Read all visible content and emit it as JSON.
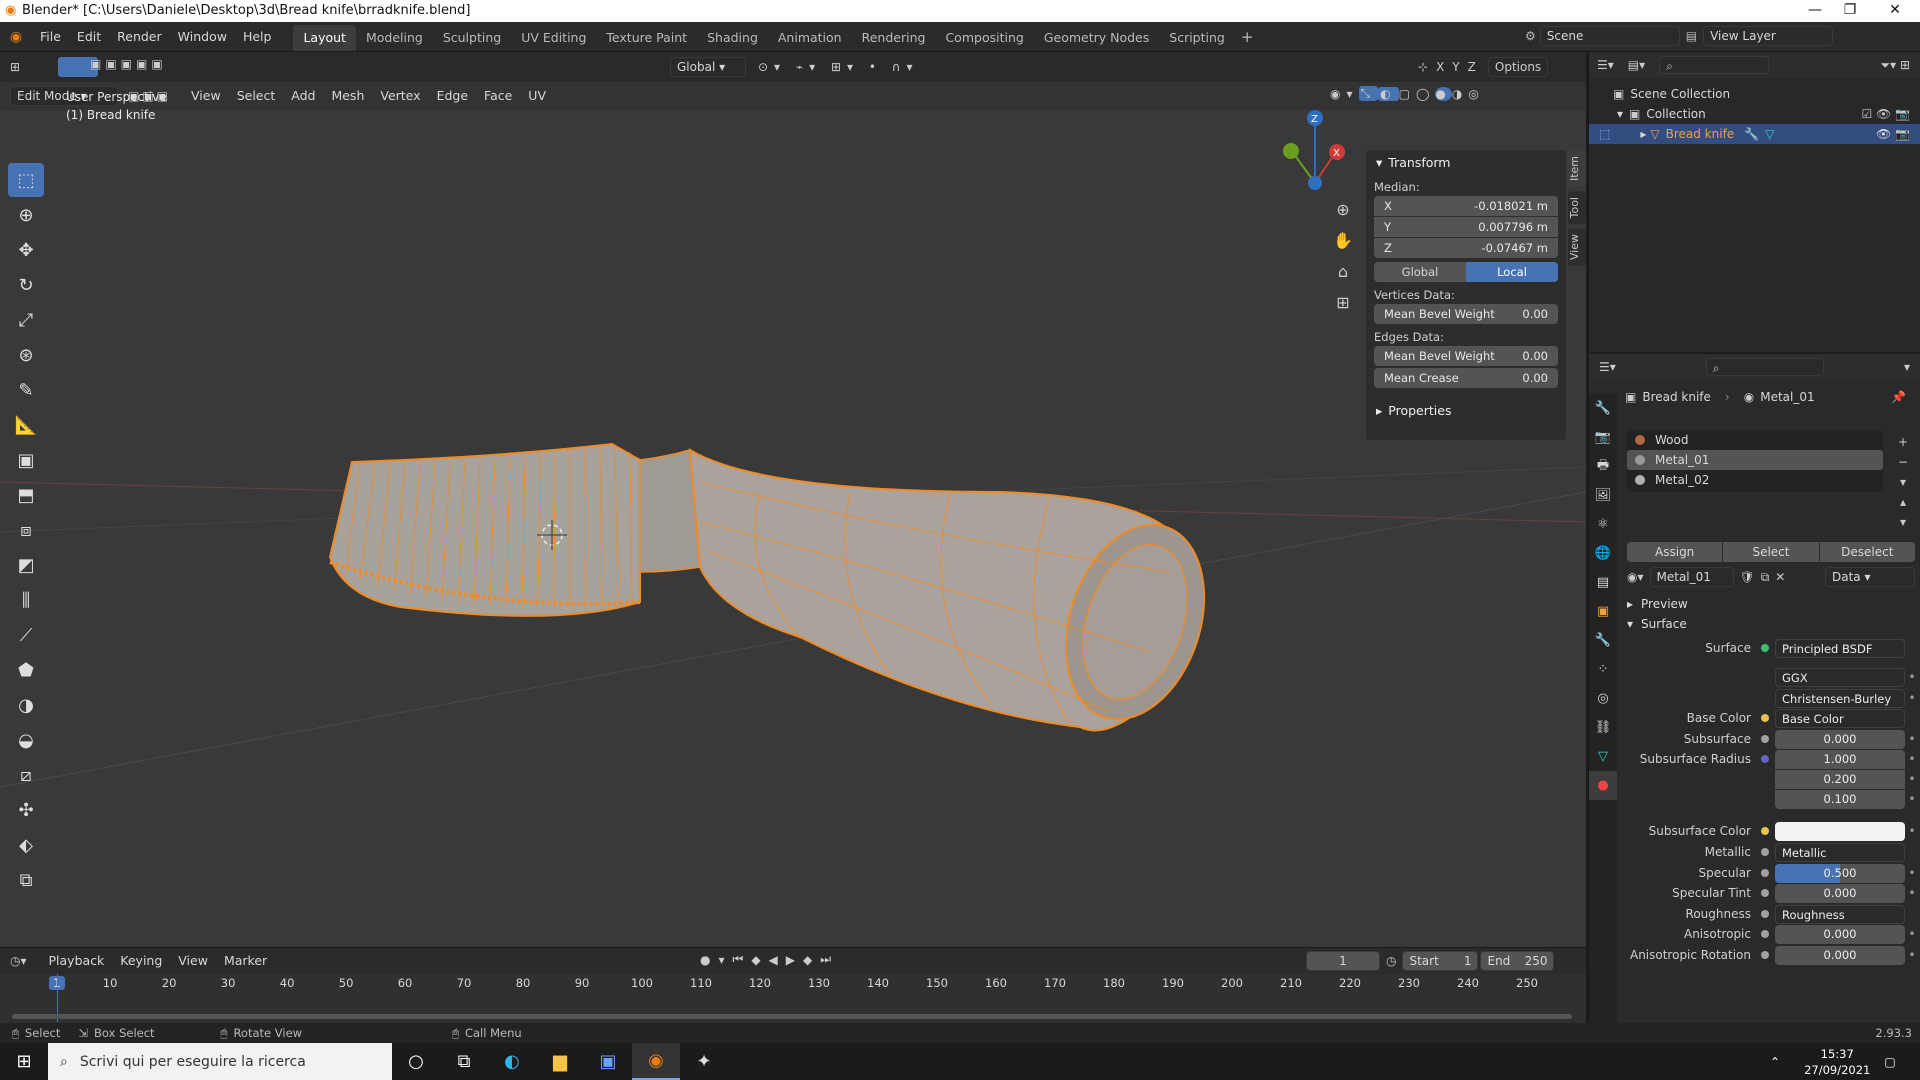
{
  "window": {
    "title": "Blender* [C:\\Users\\Daniele\\Desktop\\3d\\Bread knife\\brradknife.blend]"
  },
  "menus": [
    "File",
    "Edit",
    "Render",
    "Window",
    "Help"
  ],
  "workspaces": [
    "Layout",
    "Modeling",
    "Sculpting",
    "UV Editing",
    "Texture Paint",
    "Shading",
    "Animation",
    "Rendering",
    "Compositing",
    "Geometry Nodes",
    "Scripting"
  ],
  "scene": {
    "label": "Scene",
    "view_layer": "View Layer"
  },
  "viewport": {
    "mode": "Edit Mode",
    "menus": [
      "View",
      "Select",
      "Add",
      "Mesh",
      "Vertex",
      "Edge",
      "Face",
      "UV"
    ],
    "orientation": "Global",
    "options": "Options",
    "axes": [
      "X",
      "Y",
      "Z"
    ],
    "overlay_line1": "User Perspective",
    "overlay_line2": "(1) Bread knife",
    "gizmo": {
      "x": "X",
      "y": "Y",
      "z": "Z"
    }
  },
  "npanel": {
    "transform_title": "Transform",
    "median_label": "Median:",
    "x_label": "X",
    "x_value": "-0.018021 m",
    "y_label": "Y",
    "y_value": "0.007796 m",
    "z_label": "Z",
    "z_value": "-0.07467 m",
    "global": "Global",
    "local": "Local",
    "vertices_label": "Vertices Data:",
    "v_bevel_label": "Mean Bevel Weight",
    "v_bevel_value": "0.00",
    "edges_label": "Edges Data:",
    "e_bevel_label": "Mean Bevel Weight",
    "e_bevel_value": "0.00",
    "crease_label": "Mean Crease",
    "crease_value": "0.00",
    "properties_title": "Properties",
    "tabs": [
      "Item",
      "Tool",
      "View"
    ]
  },
  "outliner": {
    "scene_collection": "Scene Collection",
    "collection": "Collection",
    "object": "Bread knife"
  },
  "properties": {
    "object_name": "Bread knife",
    "material_name": "Metal_01",
    "slots": [
      "Wood",
      "Metal_01",
      "Metal_02"
    ],
    "assign": "Assign",
    "select": "Select",
    "deselect": "Deselect",
    "data_link": "Data",
    "preview": "Preview",
    "surface_section": "Surface",
    "surface_label": "Surface",
    "surface_value": "Principled BSDF",
    "distribution": "GGX",
    "subsurface_method": "Christensen-Burley",
    "base_color_label": "Base Color",
    "base_color_value": "Base Color",
    "subsurface_label": "Subsurface",
    "subsurface_value": "0.000",
    "ss_radius_label": "Subsurface Radius",
    "ss_radius_values": [
      "1.000",
      "0.200",
      "0.100"
    ],
    "ss_color_label": "Subsurface Color",
    "metallic_label": "Metallic",
    "metallic_value": "Metallic",
    "specular_label": "Specular",
    "specular_value": "0.500",
    "specular_fraction": 0.5,
    "spec_tint_label": "Specular Tint",
    "spec_tint_value": "0.000",
    "roughness_label": "Roughness",
    "roughness_value": "Roughness",
    "aniso_label": "Anisotropic",
    "aniso_value": "0.000",
    "aniso_rot_label": "Anisotropic Rotation",
    "aniso_rot_value": "0.000"
  },
  "timeline": {
    "menus": [
      "Playback",
      "Keying",
      "View",
      "Marker"
    ],
    "current_frame": "1",
    "start_label": "Start",
    "start_value": "1",
    "end_label": "End",
    "end_value": "250",
    "ticks": [
      "1",
      "10",
      "20",
      "30",
      "40",
      "50",
      "60",
      "70",
      "80",
      "90",
      "100",
      "110",
      "120",
      "130",
      "140",
      "150",
      "160",
      "170",
      "180",
      "190",
      "200",
      "210",
      "220",
      "230",
      "240",
      "250"
    ]
  },
  "status": {
    "select": "Select",
    "box_select": "Box Select",
    "rotate": "Rotate View",
    "call_menu": "Call Menu",
    "version": "2.93.3"
  },
  "taskbar": {
    "search_placeholder": "Scrivi qui per eseguire la ricerca",
    "time": "15:37",
    "date": "27/09/2021"
  },
  "colors": {
    "accent": "#4772b3",
    "mesh_orange": "#f08a24",
    "mesh_fill": "#a8a29c",
    "viewport_bg": "#393939"
  }
}
